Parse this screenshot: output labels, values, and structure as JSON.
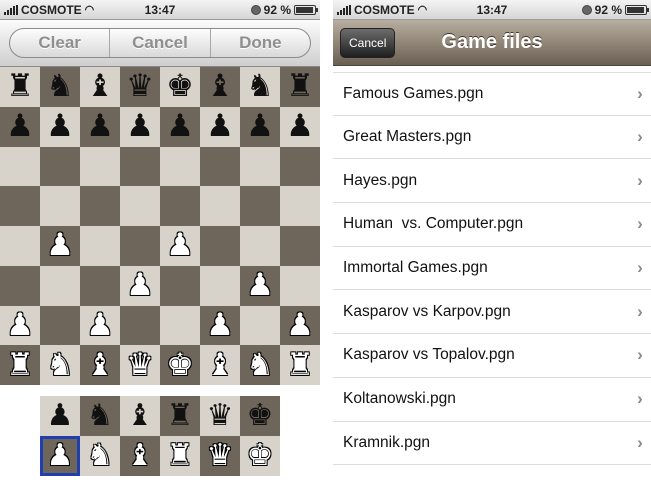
{
  "left_screen": {
    "status": {
      "carrier": "COSMOTE",
      "time": "13:47",
      "battery": "92 %",
      "battery_level": 0.92
    },
    "toolbar": {
      "clear_label": "Clear",
      "cancel_label": "Cancel",
      "done_label": "Done"
    },
    "board": [
      [
        "bR",
        "bN",
        "bB",
        "bQ",
        "bK",
        "bB",
        "bN",
        "bR"
      ],
      [
        "bP",
        "bP",
        "bP",
        "bP",
        "bP",
        "bP",
        "bP",
        "bP"
      ],
      [
        "",
        "",
        "",
        "",
        "",
        "",
        "",
        ""
      ],
      [
        "",
        "",
        "",
        "",
        "",
        "",
        "",
        ""
      ],
      [
        "",
        "wP",
        "",
        "",
        "wP",
        "",
        "",
        ""
      ],
      [
        "",
        "",
        "",
        "wP",
        "",
        "",
        "wP",
        ""
      ],
      [
        "wP",
        "",
        "wP",
        "",
        "",
        "wP",
        "",
        "wP"
      ],
      [
        "wR",
        "wN",
        "wB",
        "wQ",
        "wK",
        "wB",
        "wN",
        "wR"
      ]
    ],
    "tray": [
      [
        "bP",
        "bN",
        "bB",
        "bR",
        "bQ",
        "bK"
      ],
      [
        "wP",
        "wN",
        "wB",
        "wR",
        "wQ",
        "wK"
      ]
    ],
    "tray_selected": "wP"
  },
  "right_screen": {
    "status": {
      "carrier": "COSMOTE",
      "time": "13:47",
      "battery": "92 %",
      "battery_level": 0.92
    },
    "nav": {
      "cancel_label": "Cancel",
      "title": "Game files"
    },
    "files": [
      "Famous Games.pgn",
      "Great Masters.pgn",
      "Hayes.pgn",
      "Human  vs. Computer.pgn",
      "Immortal Games.pgn",
      "Kasparov vs Karpov.pgn",
      "Kasparov vs Topalov.pgn",
      "Koltanowski.pgn",
      "Kramnik.pgn"
    ],
    "chevron_icon": "chevron-right-icon"
  }
}
